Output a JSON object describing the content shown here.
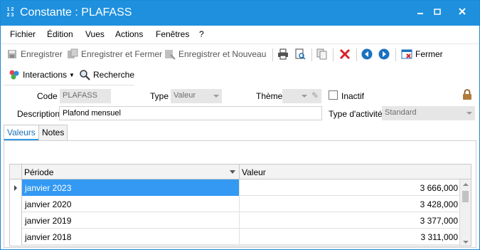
{
  "window": {
    "title": "Constante : PLAFASS",
    "app_icon_text_top": "1 2",
    "app_icon_text_bottom": "2 3"
  },
  "menu": {
    "items": [
      "Fichier",
      "Édition",
      "Vues",
      "Actions",
      "Fenêtres",
      "?"
    ]
  },
  "toolbar": {
    "save_label": "Enregistrer",
    "save_close_label": "Enregistrer et Fermer",
    "save_new_label": "Enregistrer et Nouveau",
    "close_label": "Fermer"
  },
  "toolbar2": {
    "interactions_label": "Interactions",
    "search_label": "Recherche"
  },
  "form": {
    "code_label": "Code",
    "code_value": "PLAFASS",
    "type_label": "Type",
    "type_value": "Valeur",
    "theme_label": "Thème",
    "theme_value": "",
    "inactive_label": "Inactif",
    "description_label": "Description",
    "description_value": "Plafond mensuel",
    "activity_label": "Type d'activité",
    "activity_value": "Standard"
  },
  "tabs": {
    "values_label": "Valeurs",
    "notes_label": "Notes"
  },
  "grid": {
    "columns": [
      "Période",
      "Valeur"
    ],
    "rows": [
      {
        "period": "janvier 2023",
        "value": "3 666,000"
      },
      {
        "period": "janvier 2020",
        "value": "3 428,000"
      },
      {
        "period": "janvier 2019",
        "value": "3 377,000"
      },
      {
        "period": "janvier 2018",
        "value": "3 311,000"
      }
    ]
  },
  "colors": {
    "titlebar": "#1e90de",
    "selection": "#3399f3",
    "delete": "#d9202a",
    "nav": "#1b72c0"
  }
}
